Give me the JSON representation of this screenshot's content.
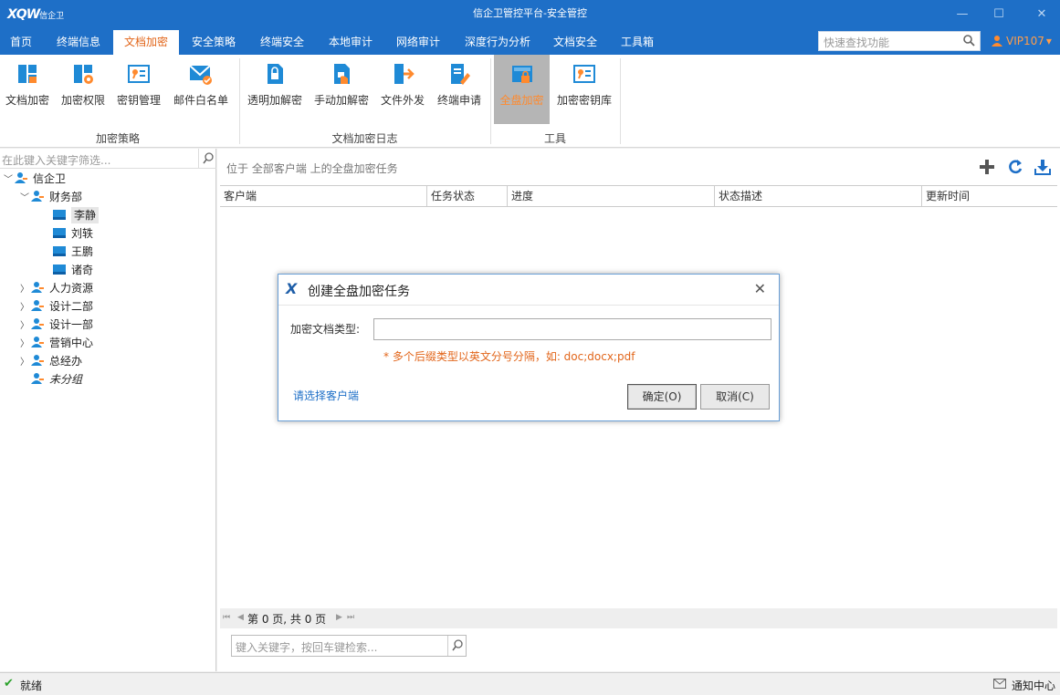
{
  "titlebar": {
    "logo_brand": "XQW",
    "logo_sub": "信企卫",
    "title": "信企卫管控平台-安全管控",
    "minimize": "—",
    "maximize": "☐",
    "close": "✕"
  },
  "menu": {
    "tabs": [
      "首页",
      "终端信息",
      "文档加密",
      "安全策略",
      "终端安全",
      "本地审计",
      "网络审计",
      "深度行为分析",
      "文档安全",
      "工具箱"
    ],
    "active": "文档加密"
  },
  "quicksearch": {
    "placeholder": "快速查找功能"
  },
  "user": {
    "label": "VIP107",
    "caret": "▾"
  },
  "ribbon": {
    "buttons": [
      "文档加密",
      "加密权限",
      "密钥管理",
      "邮件白名单",
      "透明加解密",
      "手动加解密",
      "文件外发",
      "终端申请",
      "全盘加密",
      "加密密钥库"
    ],
    "active": "全盘加密",
    "groups": [
      "加密策略",
      "文档加密日志",
      "工具"
    ]
  },
  "left": {
    "filter_placeholder": "在此键入关键字筛选...",
    "root": "信企卫",
    "dept": "财务部",
    "members": [
      "李静",
      "刘轶",
      "王鹏",
      "诸奇"
    ],
    "groups": [
      "人力资源",
      "设计二部",
      "设计一部",
      "营销中心",
      "总经办"
    ],
    "ungrouped": "未分组"
  },
  "right": {
    "location": "位于 全部客户端 上的全盘加密任务",
    "columns": [
      "客户端",
      "任务状态",
      "进度",
      "状态描述",
      "更新时间"
    ],
    "pager": "第 0 页, 共 0 页",
    "search_placeholder": "键入关键字，按回车键检索..."
  },
  "status": {
    "ready": "就绪",
    "notify": "通知中心"
  },
  "dialog": {
    "title": "创建全盘加密任务",
    "field_label": "加密文档类型:",
    "field_value": "",
    "hint": "* 多个后缀类型以英文分号分隔，如: doc;docx;pdf",
    "link": "请选择客户端",
    "ok": "确定(O)",
    "cancel": "取消(C)"
  },
  "colors": {
    "brand_blue": "#1e6fc7",
    "active_orange": "#e2661b",
    "ribbon_icon_blue": "#1f8ad6"
  }
}
